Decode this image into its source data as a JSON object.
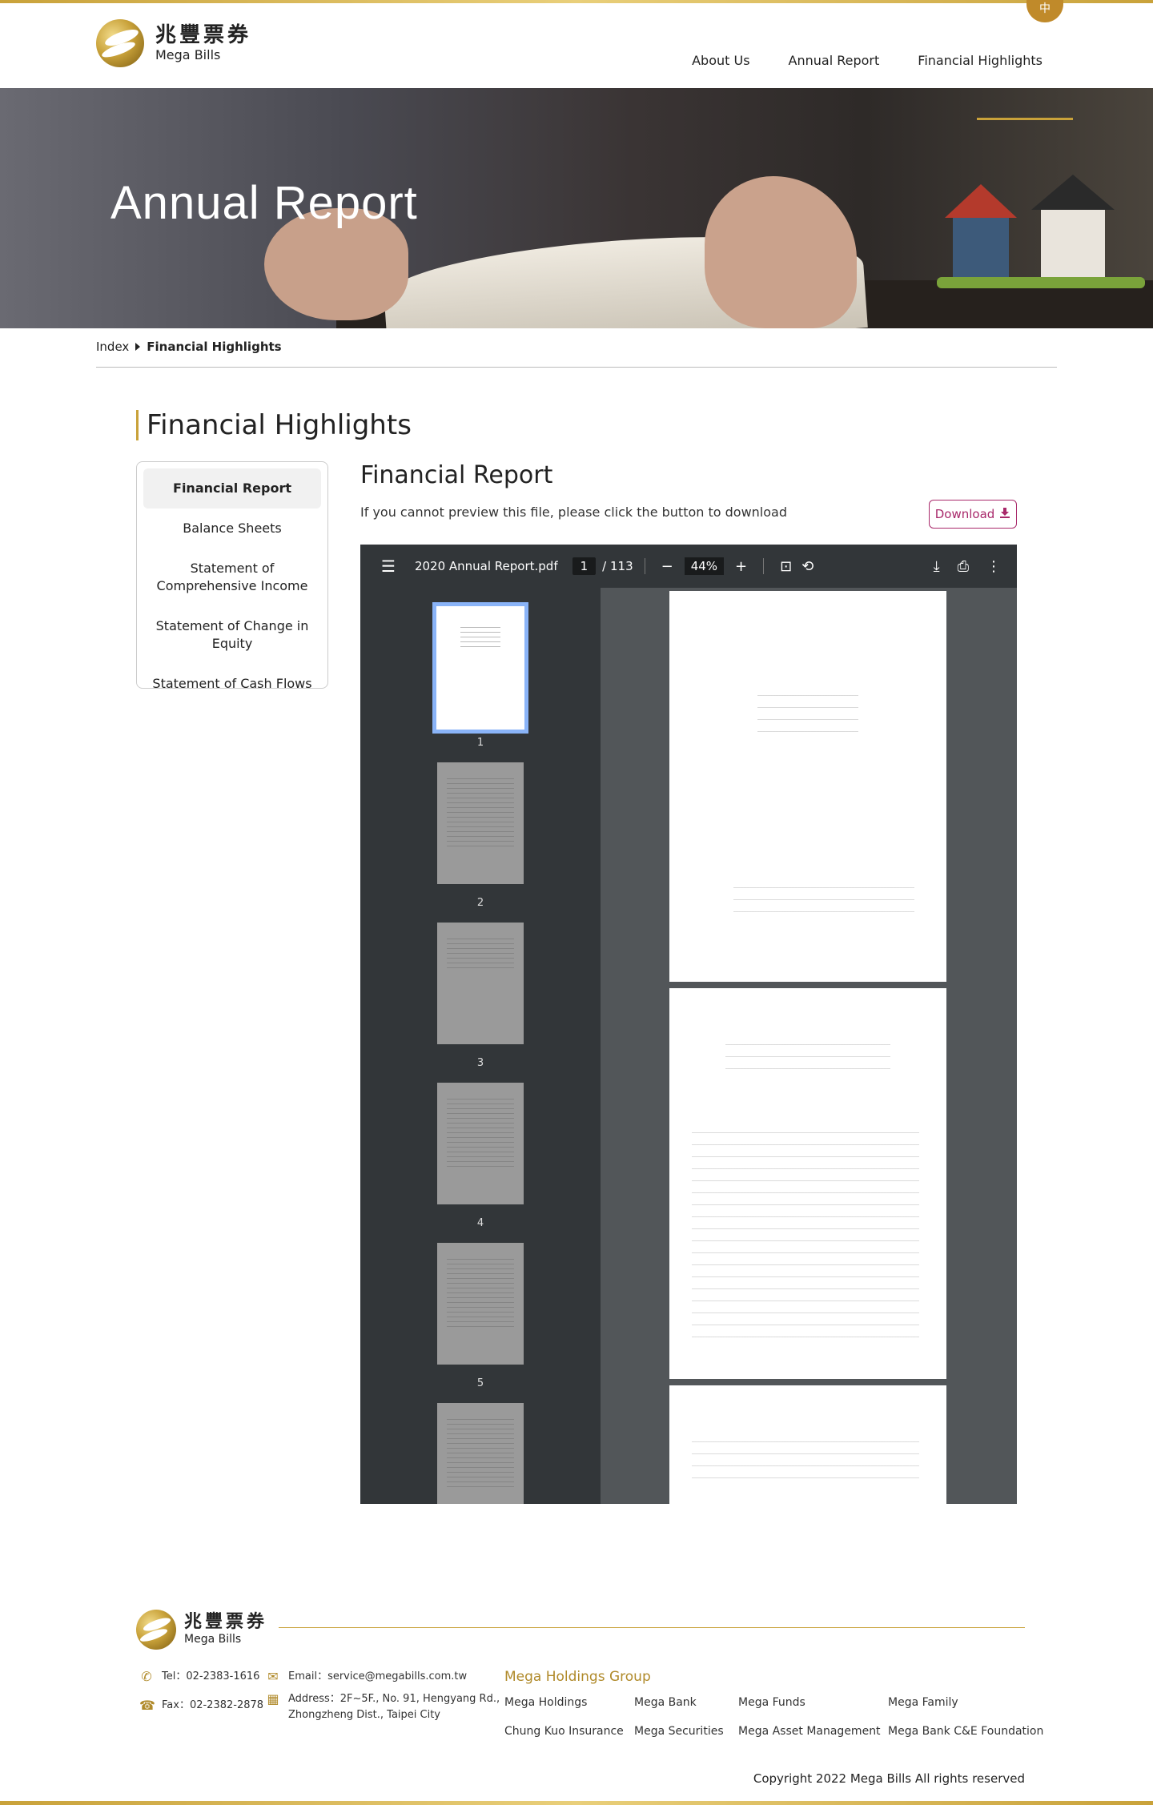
{
  "header": {
    "logo_cn": "兆豐票券",
    "logo_en": "Mega Bills",
    "lang_label": "中",
    "nav": [
      "About Us",
      "Annual Report",
      "Financial Highlights"
    ]
  },
  "hero": {
    "title": "Annual Report"
  },
  "breadcrumb": {
    "index": "Index",
    "current": "Financial Highlights"
  },
  "section_title": "Financial Highlights",
  "side_menu": [
    "Financial Report",
    "Balance Sheets",
    "Statement of Comprehensive Income",
    "Statement of Change in Equity",
    "Statement of Cash Flows"
  ],
  "content": {
    "title": "Financial Report",
    "note": "If you cannot preview this file, please click the button to download",
    "download_label": "Download"
  },
  "pdf_viewer": {
    "filename": "2020 Annual Report.pdf",
    "current_page": "1",
    "total_pages": "/ 113",
    "zoom": "44%",
    "thumbnails": [
      "1",
      "2",
      "3",
      "4",
      "5"
    ]
  },
  "footer": {
    "logo_cn": "兆豐票券",
    "logo_en": "Mega Bills",
    "tel": "Tel：02-2383-1616",
    "fax": "Fax：02-2382-2878",
    "email": "Email：service@megabills.com.tw",
    "address_line1": "Address：2F~5F., No. 91, Hengyang Rd.,",
    "address_line2": "Zhongzheng Dist., Taipei City",
    "group_title": "Mega Holdings Group",
    "group_links": [
      "Mega Holdings",
      "Mega Bank",
      "Mega Funds",
      "Mega Family",
      "Chung Kuo Insurance",
      "Mega Securities",
      "Mega Asset Management",
      "Mega Bank C&E Foundation"
    ],
    "copyright": "Copyright 2022 Mega Bills All rights reserved"
  },
  "colors": {
    "gold": "#c9a23a",
    "download_accent": "#a8286a",
    "viewer_dark": "#323639"
  }
}
